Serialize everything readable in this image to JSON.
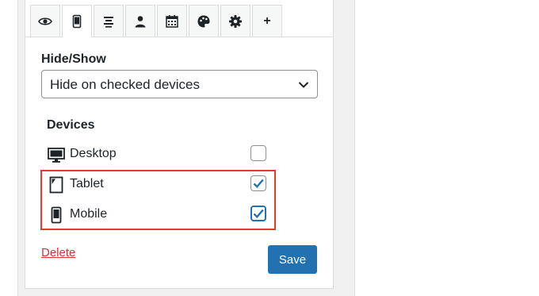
{
  "tabs": [
    {
      "icon": "eye-icon",
      "active": false
    },
    {
      "icon": "mobile-icon",
      "active": true
    },
    {
      "icon": "align-center-icon",
      "active": false
    },
    {
      "icon": "user-icon",
      "active": false
    },
    {
      "icon": "calendar-icon",
      "active": false
    },
    {
      "icon": "palette-icon",
      "active": false
    },
    {
      "icon": "gear-icon",
      "active": false
    },
    {
      "icon": "plus-icon",
      "label": "+",
      "active": false
    }
  ],
  "visibility": {
    "label": "Hide/Show",
    "selected": "Hide on checked devices"
  },
  "devices": {
    "label": "Devices",
    "items": [
      {
        "label": "Desktop",
        "checked": false,
        "icon": "desktop-icon"
      },
      {
        "label": "Tablet",
        "checked": true,
        "icon": "tablet-icon"
      },
      {
        "label": "Mobile",
        "checked": true,
        "icon": "mobile-icon"
      }
    ]
  },
  "actions": {
    "delete_label": "Delete",
    "save_label": "Save"
  },
  "colors": {
    "primary": "#2271b1",
    "delete": "#d63638",
    "highlight": "#e53b2c"
  }
}
